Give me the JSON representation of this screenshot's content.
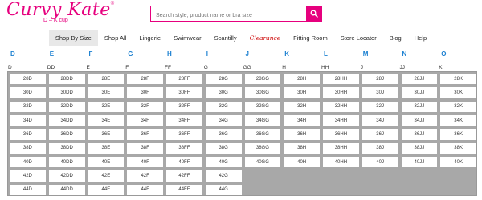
{
  "brand": {
    "name": "Curvy Kate",
    "mark": "®",
    "tagline": "D – K cup"
  },
  "search": {
    "placeholder": "Search style, product name or bra size"
  },
  "nav": [
    {
      "label": "Shop By Size",
      "active": true
    },
    {
      "label": "Shop All"
    },
    {
      "label": "Lingerie"
    },
    {
      "label": "Swimwear"
    },
    {
      "label": "Scantilly"
    },
    {
      "label": "Clearance",
      "special": "clearance"
    },
    {
      "label": "Fitting Room"
    },
    {
      "label": "Store Locator"
    },
    {
      "label": "Blog"
    },
    {
      "label": "Help"
    }
  ],
  "cup_letters": [
    {
      "label": "D",
      "color": "#1a7fd0"
    },
    {
      "label": "E",
      "color": "#1a7fd0"
    },
    {
      "label": "F",
      "color": "#1a7fd0"
    },
    {
      "label": "G",
      "color": "#1a7fd0"
    },
    {
      "label": "H",
      "color": "#1a7fd0"
    },
    {
      "label": "I",
      "color": "#1a7fd0"
    },
    {
      "label": "J",
      "color": "#1a7fd0"
    },
    {
      "label": "K",
      "color": "#1a7fd0"
    },
    {
      "label": "L",
      "color": "#1a7fd0"
    },
    {
      "label": "M",
      "color": "#1a7fd0"
    },
    {
      "label": "N",
      "color": "#1a7fd0"
    },
    {
      "label": "O",
      "color": "#1a7fd0"
    }
  ],
  "columns": [
    "D",
    "DD",
    "E",
    "F",
    "FF",
    "G",
    "GG",
    "H",
    "HH",
    "J",
    "JJ",
    "K"
  ],
  "rows": [
    [
      "28D",
      "28DD",
      "28E",
      "28F",
      "28FF",
      "28G",
      "28GG",
      "28H",
      "28HH",
      "28J",
      "28JJ",
      "28K"
    ],
    [
      "30D",
      "30DD",
      "30E",
      "30F",
      "30FF",
      "30G",
      "30GG",
      "30H",
      "30HH",
      "30J",
      "30JJ",
      "30K"
    ],
    [
      "32D",
      "32DD",
      "32E",
      "32F",
      "32FF",
      "32G",
      "32GG",
      "32H",
      "32HH",
      "32J",
      "32JJ",
      "32K"
    ],
    [
      "34D",
      "34DD",
      "34E",
      "34F",
      "34FF",
      "34G",
      "34GG",
      "34H",
      "34HH",
      "34J",
      "34JJ",
      "34K"
    ],
    [
      "36D",
      "36DD",
      "36E",
      "36F",
      "36FF",
      "36G",
      "36GG",
      "36H",
      "36HH",
      "36J",
      "36JJ",
      "36K"
    ],
    [
      "38D",
      "38DD",
      "38E",
      "38F",
      "38FF",
      "38G",
      "38GG",
      "38H",
      "38HH",
      "38J",
      "38JJ",
      "38K"
    ],
    [
      "40D",
      "40DD",
      "40E",
      "40F",
      "40FF",
      "40G",
      "40GG",
      "40H",
      "40HH",
      "40J",
      "40JJ",
      "40K"
    ],
    [
      "42D",
      "42DD",
      "42E",
      "42F",
      "42FF",
      "42G",
      "",
      "",
      "",
      "",
      "",
      ""
    ],
    [
      "44D",
      "44DD",
      "44E",
      "44F",
      "44FF",
      "44G",
      "",
      "",
      "",
      "",
      "",
      ""
    ]
  ],
  "colors": {
    "accent": "#e6007e",
    "cup_letter": "#1a7fd0",
    "clearance": "#cc0000"
  }
}
